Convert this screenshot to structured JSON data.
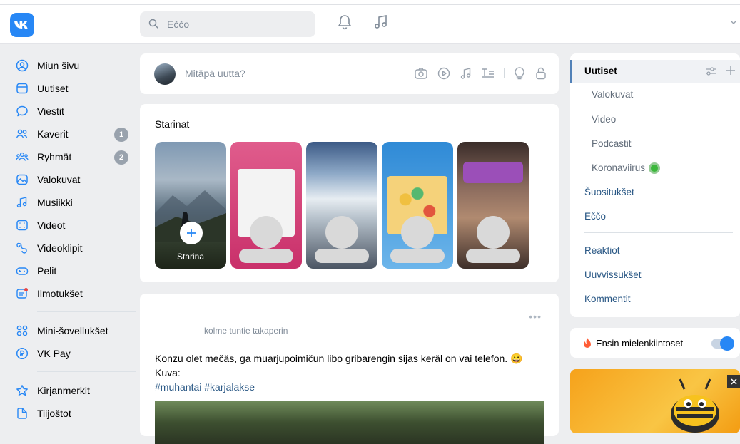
{
  "header": {
    "logo_text": "VK",
    "search_placeholder": "Eččo"
  },
  "sidebar": {
    "items": [
      {
        "label": "Miun šivu",
        "icon": "user-circle-icon"
      },
      {
        "label": "Uutiset",
        "icon": "newspaper-icon"
      },
      {
        "label": "Viestit",
        "icon": "message-icon"
      },
      {
        "label": "Kaverit",
        "icon": "friends-icon",
        "badge": "1"
      },
      {
        "label": "Ryhmät",
        "icon": "groups-icon",
        "badge": "2"
      },
      {
        "label": "Valokuvat",
        "icon": "photo-icon"
      },
      {
        "label": "Musiikki",
        "icon": "music-icon"
      },
      {
        "label": "Videot",
        "icon": "video-icon"
      },
      {
        "label": "Videoklipit",
        "icon": "clips-icon"
      },
      {
        "label": "Pelit",
        "icon": "gamepad-icon"
      },
      {
        "label": "Ilmotukšet",
        "icon": "ads-icon"
      },
      {
        "label": "Mini-šovellukšet",
        "icon": "apps-icon"
      },
      {
        "label": "VK Pay",
        "icon": "vkpay-icon"
      },
      {
        "label": "Kirjanmerkit",
        "icon": "star-icon"
      },
      {
        "label": "Tiijoštot",
        "icon": "files-icon"
      }
    ]
  },
  "composer": {
    "placeholder": "Mitäpä uutta?"
  },
  "stories": {
    "title": "Starinat",
    "add_label": "Starina"
  },
  "post": {
    "time": "kolme tuntie takaperin",
    "text": "Konzu olet mečäs, ga muarjupoimičun libo gribarengin sijas keräl on vai telefon. 😀",
    "kuva": "Kuva:",
    "tags": "#muhantai #karjalakse",
    "more": "•••"
  },
  "right_menu": {
    "active": "Uutiset",
    "subitems": [
      "Valokuvat",
      "Video",
      "Podcastit",
      "Koronaviirus"
    ],
    "links1": [
      "Šuositukšet",
      "Eččo"
    ],
    "links2": [
      "Reaktiot",
      "Uuvvissukšet",
      "Kommentit"
    ]
  },
  "toggle": {
    "label": "Ensin mielenkiintoset",
    "enabled": true
  },
  "colors": {
    "accent": "#2787f5",
    "link": "#2a5885",
    "background": "#edeef0"
  }
}
